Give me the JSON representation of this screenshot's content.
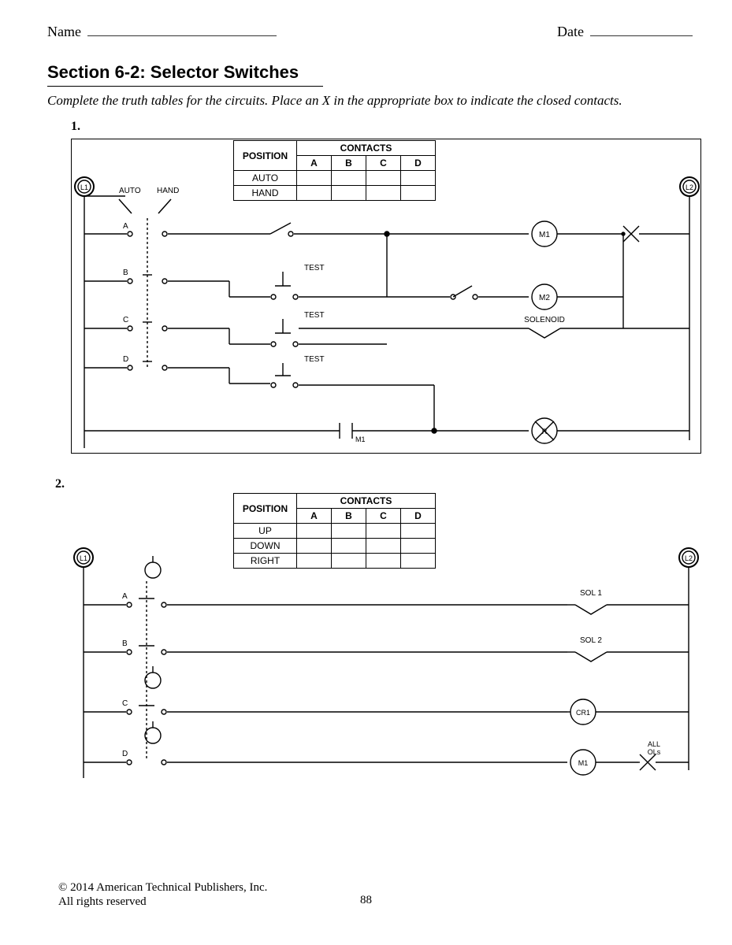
{
  "header": {
    "name_label": "Name",
    "date_label": "Date"
  },
  "section": {
    "title": "Section 6-2: Selector Switches",
    "instructions": "Complete the truth tables for the circuits. Place an X in the appropriate box to indicate the closed contacts."
  },
  "q1": {
    "number": "1.",
    "table_headers": {
      "position": "POSITION",
      "contacts": "CONTACTS",
      "cols": [
        "A",
        "B",
        "C",
        "D"
      ]
    },
    "positions": [
      "AUTO",
      "HAND"
    ],
    "selector": {
      "left": "AUTO",
      "right": "HAND"
    },
    "contacts": [
      "A",
      "B",
      "C",
      "D"
    ],
    "tests": [
      "TEST",
      "TEST",
      "TEST"
    ],
    "outputs": {
      "m1": "M1",
      "m2": "M2",
      "sol": "SOLENOID",
      "r": "R",
      "m1_aux": "M1",
      "l1": "L1",
      "l2": "L2"
    }
  },
  "q2": {
    "number": "2.",
    "table_headers": {
      "position": "POSITION",
      "contacts": "CONTACTS",
      "cols": [
        "A",
        "B",
        "C",
        "D"
      ]
    },
    "positions": [
      "UP",
      "DOWN",
      "RIGHT"
    ],
    "contacts": [
      "A",
      "B",
      "C",
      "D"
    ],
    "outputs": {
      "sol1": "SOL 1",
      "sol2": "SOL 2",
      "cr1": "CR1",
      "m1": "M1",
      "ols": "ALL\nOLs",
      "l1": "L1",
      "l2": "L2"
    }
  },
  "footer": {
    "copyright": "© 2014 American Technical Publishers, Inc.",
    "rights": "All rights reserved",
    "page": "88"
  }
}
